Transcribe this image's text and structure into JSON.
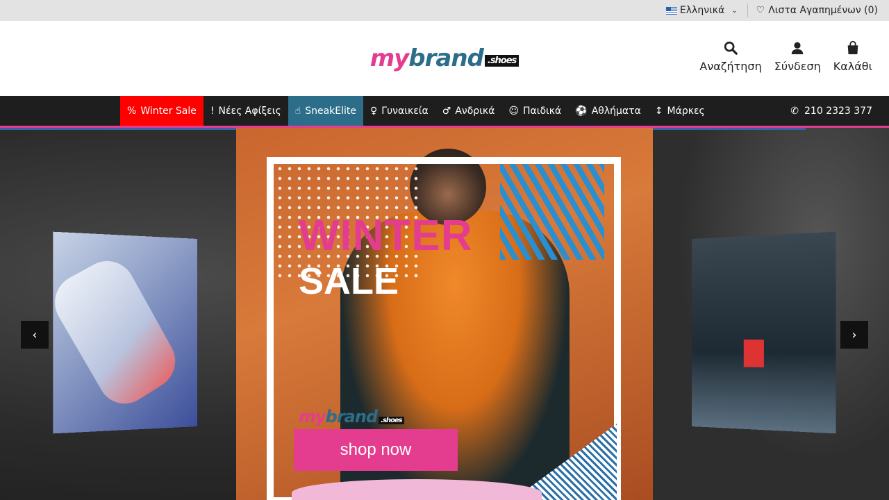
{
  "topbar": {
    "language": "Ελληνικά",
    "wishlist": "Λιστα Αγαπημένων (0)"
  },
  "header": {
    "logo_my": "my",
    "logo_brand": "brand",
    "logo_tld": ".shoes",
    "search_label": "Αναζήτηση",
    "login_label": "Σύνδεση",
    "cart_label": "Καλάθι"
  },
  "nav": {
    "items": [
      {
        "label": "Winter Sale",
        "icon": "percent-icon"
      },
      {
        "label": "Νέες Αφίξεις",
        "icon": "exclamation-icon"
      },
      {
        "label": "SneakElite",
        "icon": "hand-icon"
      },
      {
        "label": "Γυναικεία",
        "icon": "woman-icon"
      },
      {
        "label": "Ανδρικά",
        "icon": "man-icon"
      },
      {
        "label": "Παιδικά",
        "icon": "child-icon"
      },
      {
        "label": "Αθλήματα",
        "icon": "soccer-ball-icon"
      },
      {
        "label": "Μάρκες",
        "icon": "sort-az-icon"
      }
    ],
    "phone": "210 2323 377"
  },
  "hero": {
    "title_line1": "WINTER",
    "title_line2": "SALE",
    "banner_logo_my": "my",
    "banner_logo_brand": "brand",
    "banner_logo_tld": ".shoes",
    "cta": "shop now",
    "prev_arrow": "‹",
    "next_arrow": "›"
  },
  "colors": {
    "accent_pink": "#e43c8f",
    "brand_teal": "#2c6e8a",
    "sale_red": "#ff0000",
    "nav_dark": "#1e1e1e"
  }
}
